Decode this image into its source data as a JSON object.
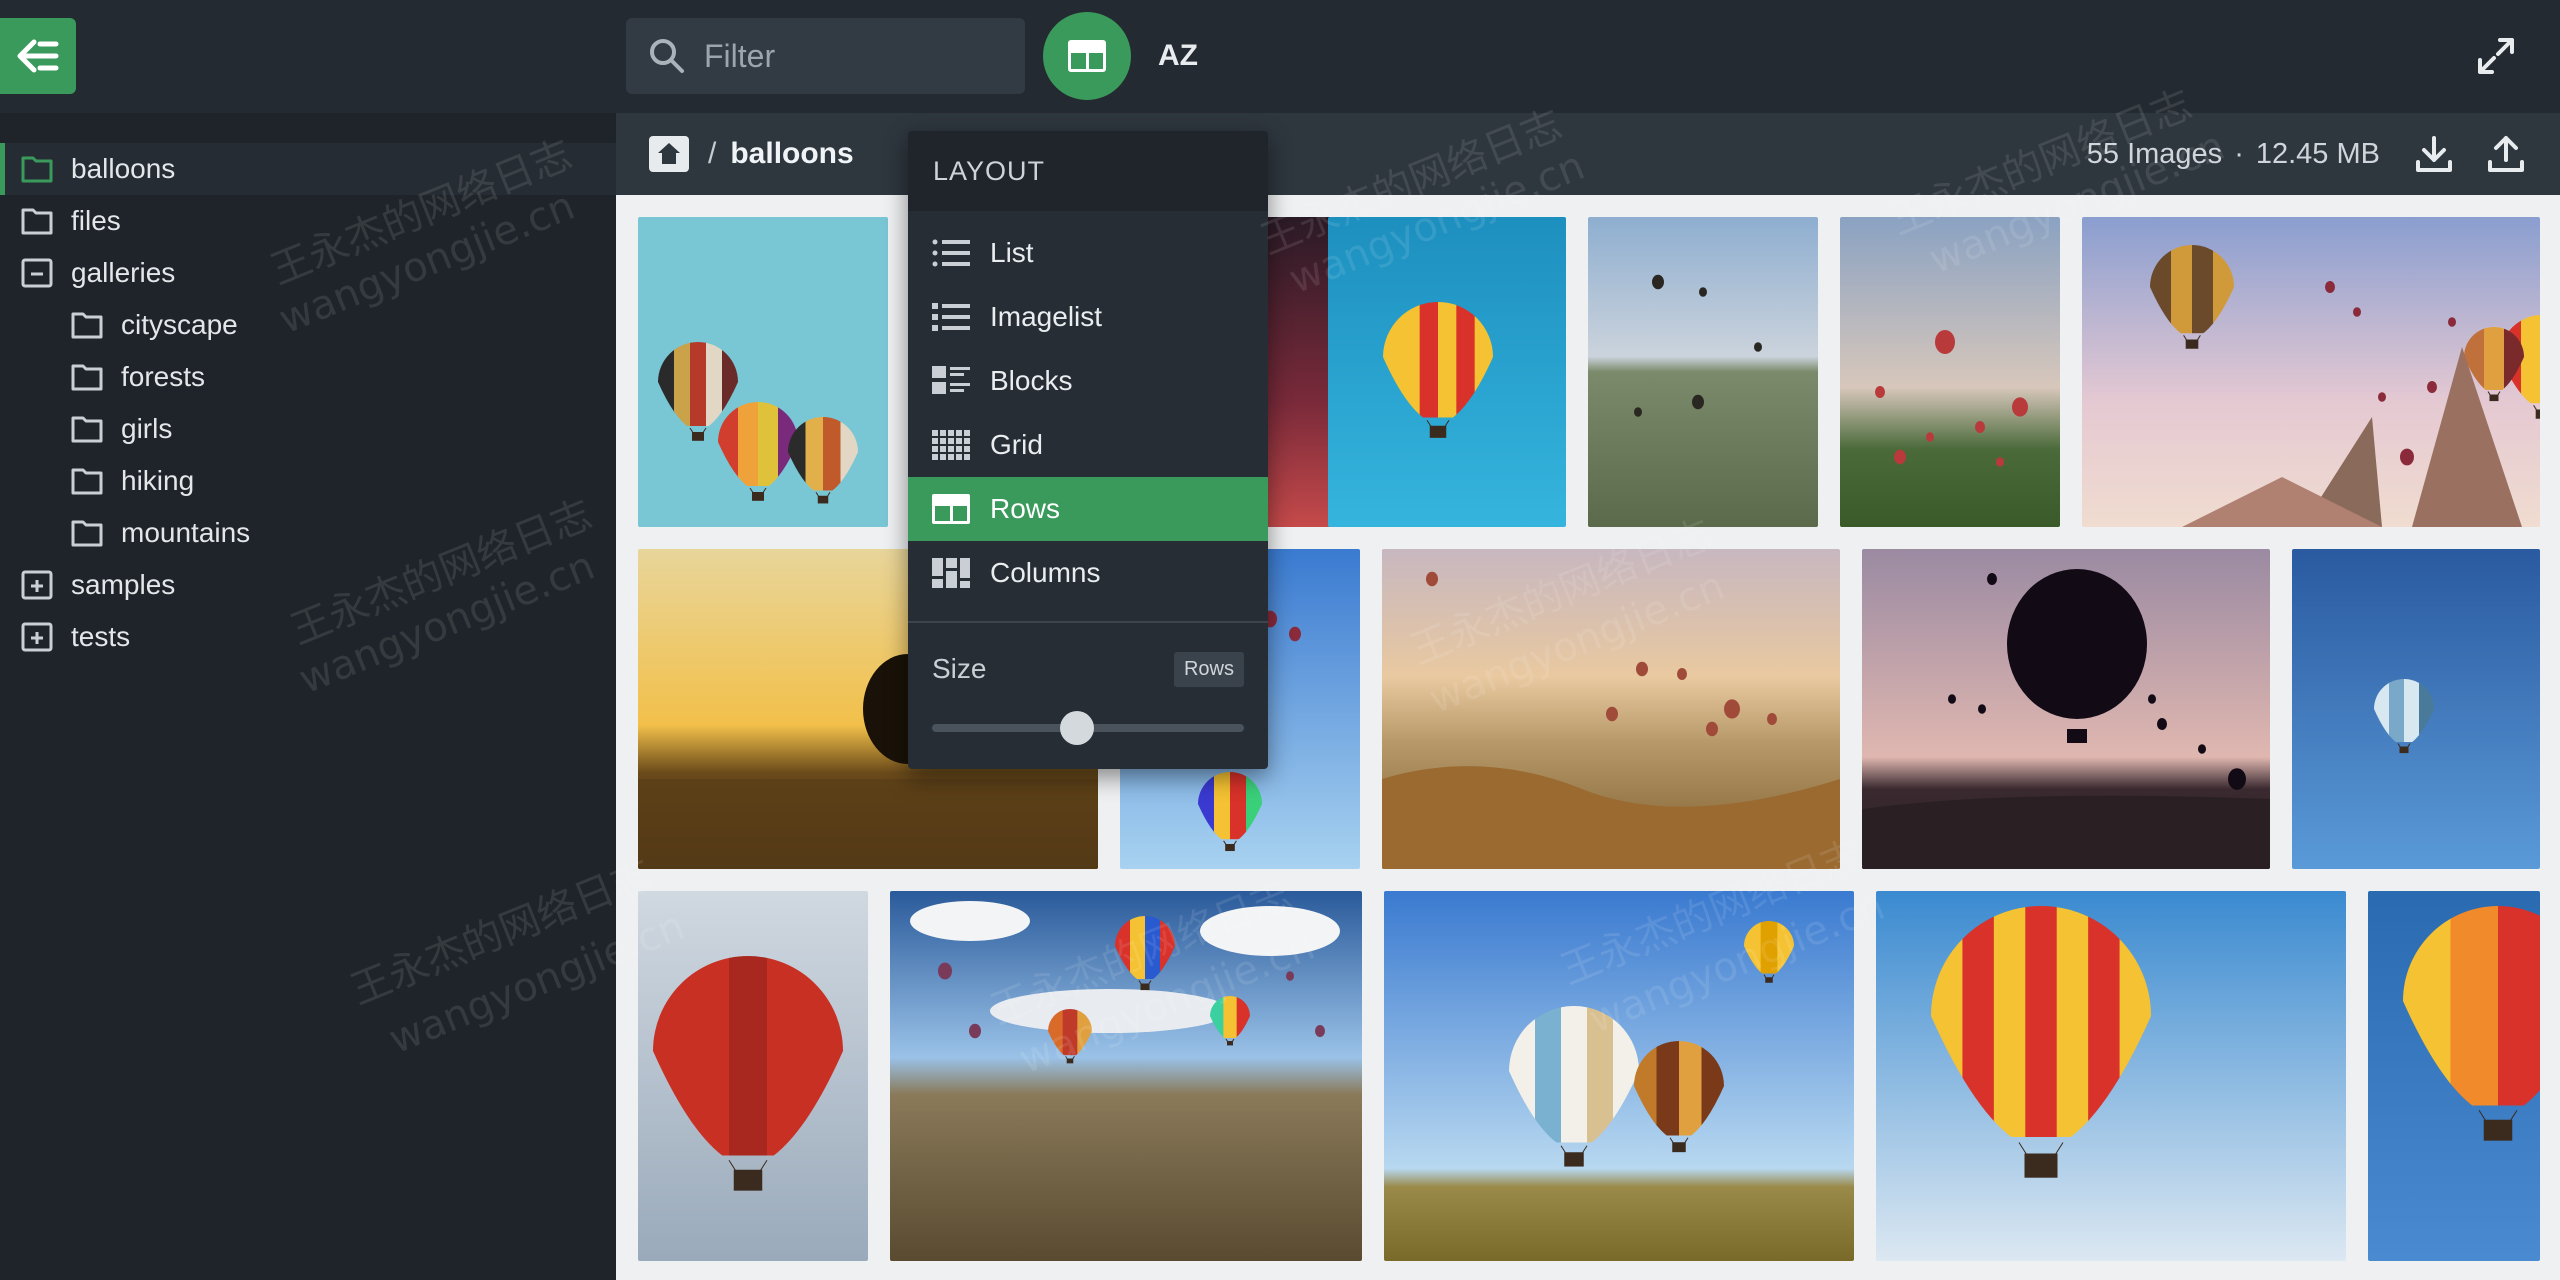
{
  "topbar": {
    "filter_placeholder": "Filter",
    "sort_label": "AZ",
    "accent": "#3a9a5b"
  },
  "sidebar": {
    "items": [
      {
        "label": "balloons",
        "level": 0,
        "icon": "folder-icon",
        "active": true
      },
      {
        "label": "files",
        "level": 0,
        "icon": "folder-icon"
      },
      {
        "label": "galleries",
        "level": 0,
        "icon": "folder-minus-icon"
      },
      {
        "label": "cityscape",
        "level": 1,
        "icon": "folder-icon"
      },
      {
        "label": "forests",
        "level": 1,
        "icon": "folder-icon"
      },
      {
        "label": "girls",
        "level": 1,
        "icon": "folder-icon"
      },
      {
        "label": "hiking",
        "level": 1,
        "icon": "folder-icon"
      },
      {
        "label": "mountains",
        "level": 1,
        "icon": "folder-icon"
      },
      {
        "label": "samples",
        "level": 0,
        "icon": "folder-plus-icon"
      },
      {
        "label": "tests",
        "level": 0,
        "icon": "folder-plus-icon"
      }
    ]
  },
  "breadcrumb": {
    "separator": "/",
    "current": "balloons",
    "image_count": "55 Images",
    "dot": "·",
    "total_size": "12.45 MB"
  },
  "layout_menu": {
    "title": "LAYOUT",
    "items": [
      {
        "label": "List",
        "icon": "list-icon"
      },
      {
        "label": "Imagelist",
        "icon": "imagelist-icon"
      },
      {
        "label": "Blocks",
        "icon": "blocks-icon"
      },
      {
        "label": "Grid",
        "icon": "grid-icon"
      },
      {
        "label": "Rows",
        "icon": "rows-icon",
        "selected": true
      },
      {
        "label": "Columns",
        "icon": "columns-icon"
      }
    ],
    "size_label": "Size",
    "size_badge": "Rows",
    "size_value": 0.46
  },
  "watermark": {
    "text_cn": "王永杰的网络日志",
    "text_en": "wangyongjie.cn"
  }
}
